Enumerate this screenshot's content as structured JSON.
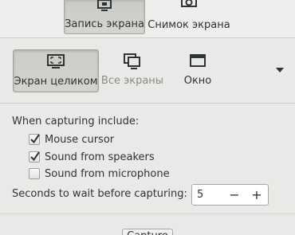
{
  "mode_tabs": {
    "record_label": "Запись экрана",
    "screenshot_label": "Снимок экрана",
    "active": "record"
  },
  "capture_area": {
    "fullscreen_label": "Экран целиком",
    "all_screens_label": "Все экраны",
    "window_label": "Окно",
    "active": "fullscreen"
  },
  "options": {
    "heading": "When capturing include:",
    "mouse_cursor": {
      "label": "Mouse cursor",
      "checked": true
    },
    "speakers": {
      "label": "Sound from speakers",
      "checked": true
    },
    "microphone": {
      "label": "Sound from microphone",
      "checked": false
    }
  },
  "delay": {
    "label": "Seconds to wait before capturing:",
    "value": "5",
    "minus": "−",
    "plus": "+"
  },
  "bottom_button": {
    "label": "Capture"
  },
  "icons": {
    "record": "screen-record-icon",
    "screenshot": "camera-icon",
    "fullscreen": "fullscreen-icon",
    "all_screens": "multiple-screens-icon",
    "window": "window-icon",
    "dropdown": "dropdown-arrow-icon"
  }
}
